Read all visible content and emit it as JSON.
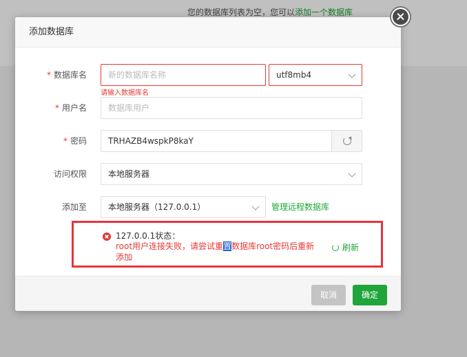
{
  "background": {
    "empty_text": "您的数据库列表为空，您可以",
    "empty_link": "添加一个数据库"
  },
  "dialog": {
    "title": "添加数据库",
    "fields": {
      "db_name": {
        "label": "数据库名",
        "placeholder": "新的数据库名称",
        "error": "请输入数据库名",
        "charset": "utf8mb4"
      },
      "user": {
        "label": "用户名",
        "placeholder": "数据库用户"
      },
      "password": {
        "label": "密码",
        "value": "TRHAZB4wspkP8kaY"
      },
      "access": {
        "label": "访问权限",
        "value": "本地服务器"
      },
      "add_to": {
        "label": "添加至",
        "value": "本地服务器（127.0.0.1）",
        "manage_link": "管理远程数据库"
      }
    },
    "status": {
      "title": "127.0.0.1状态：",
      "msg_before": "root用户连接失败，请尝试重",
      "msg_selected": "置",
      "msg_after": "数据库root密码后重新添加",
      "refresh": "刷新"
    },
    "footer": {
      "cancel": "取消",
      "confirm": "确定"
    }
  },
  "colors": {
    "accent": "#20a53a",
    "error": "#e53935"
  }
}
